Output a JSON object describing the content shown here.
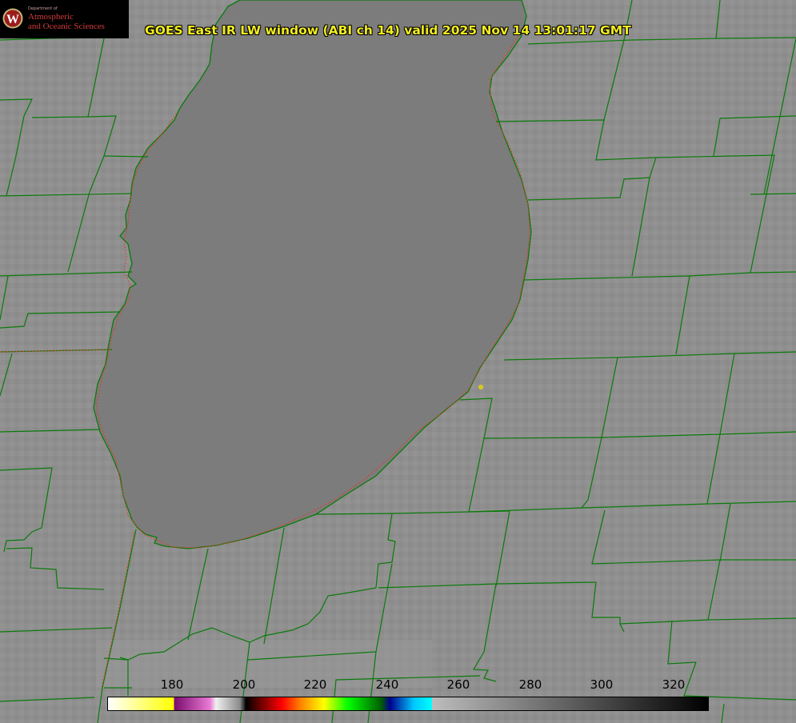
{
  "title": "GOES East IR LW window (ABI ch 14) valid 2025 Nov 14 13:01:17 GMT",
  "logo": {
    "seal_letter": "W",
    "department": "Department of",
    "line1": "Atmospheric",
    "line2": "and Oceanic Sciences"
  },
  "colorbar": {
    "labels": [
      "180",
      "200",
      "220",
      "240",
      "260",
      "280",
      "300",
      "320"
    ]
  },
  "colors": {
    "land": "#8f8f8f",
    "lake": "#7c7c7c",
    "boundaries": "#0a7a0a",
    "coast_dotted": "#e23a2a",
    "title_text": "#f2ec1e",
    "marker": "#d8cc1a"
  },
  "map_features": [
    "lake",
    "county-boundaries",
    "state-boundary",
    "shoreline",
    "location-marker"
  ]
}
